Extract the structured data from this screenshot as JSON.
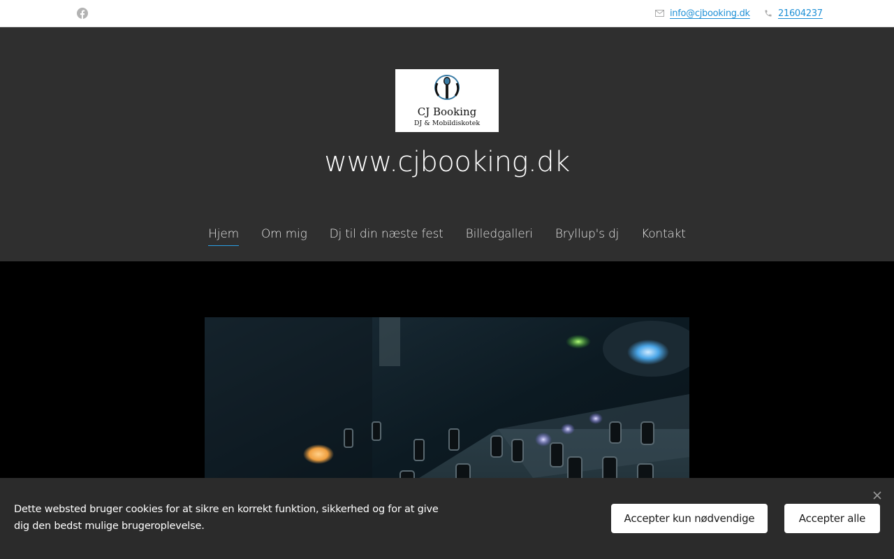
{
  "topbar": {
    "facebook_icon": "facebook-icon",
    "email": "info@cjbooking.dk",
    "phone": "21604237",
    "mail_icon": "mail-icon",
    "phone_icon": "phone-icon"
  },
  "header": {
    "logo": {
      "name": "CJ Booking",
      "tagline": "DJ & Mobildiskotek"
    },
    "title": "www.cjbooking.dk",
    "nav": [
      "Hjem",
      "Om mig",
      "Dj til din næste fest",
      "Billedgalleri",
      "Bryllup's dj",
      "Kontakt"
    ],
    "active_nav": "Hjem",
    "accent": "#2aa0e6"
  },
  "cookie": {
    "text": "Dette websted bruger cookies for at sikre en korrekt funktion, sikkerhed og for at give dig den bedst mulige brugeroplevelse.",
    "button_necessary": "Accepter kun nødvendige",
    "button_all": "Accepter alle",
    "close_icon": "close-icon"
  },
  "colors": {
    "header_bg": "#2f2f2f",
    "link": "#1e90d6",
    "cookie_bg": "#2b2b2b"
  }
}
